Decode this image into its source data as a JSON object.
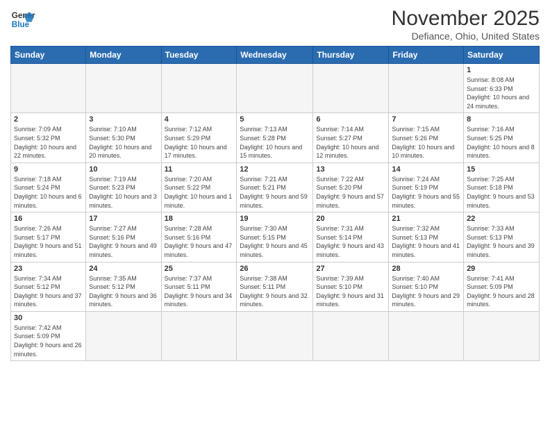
{
  "header": {
    "logo_general": "General",
    "logo_blue": "Blue",
    "month_title": "November 2025",
    "location": "Defiance, Ohio, United States"
  },
  "days_of_week": [
    "Sunday",
    "Monday",
    "Tuesday",
    "Wednesday",
    "Thursday",
    "Friday",
    "Saturday"
  ],
  "weeks": [
    [
      {
        "day": "",
        "info": ""
      },
      {
        "day": "",
        "info": ""
      },
      {
        "day": "",
        "info": ""
      },
      {
        "day": "",
        "info": ""
      },
      {
        "day": "",
        "info": ""
      },
      {
        "day": "",
        "info": ""
      },
      {
        "day": "1",
        "info": "Sunrise: 8:08 AM\nSunset: 6:33 PM\nDaylight: 10 hours and 24 minutes."
      }
    ],
    [
      {
        "day": "2",
        "info": "Sunrise: 7:09 AM\nSunset: 5:32 PM\nDaylight: 10 hours and 22 minutes."
      },
      {
        "day": "3",
        "info": "Sunrise: 7:10 AM\nSunset: 5:30 PM\nDaylight: 10 hours and 20 minutes."
      },
      {
        "day": "4",
        "info": "Sunrise: 7:12 AM\nSunset: 5:29 PM\nDaylight: 10 hours and 17 minutes."
      },
      {
        "day": "5",
        "info": "Sunrise: 7:13 AM\nSunset: 5:28 PM\nDaylight: 10 hours and 15 minutes."
      },
      {
        "day": "6",
        "info": "Sunrise: 7:14 AM\nSunset: 5:27 PM\nDaylight: 10 hours and 12 minutes."
      },
      {
        "day": "7",
        "info": "Sunrise: 7:15 AM\nSunset: 5:26 PM\nDaylight: 10 hours and 10 minutes."
      },
      {
        "day": "8",
        "info": "Sunrise: 7:16 AM\nSunset: 5:25 PM\nDaylight: 10 hours and 8 minutes."
      }
    ],
    [
      {
        "day": "9",
        "info": "Sunrise: 7:18 AM\nSunset: 5:24 PM\nDaylight: 10 hours and 6 minutes."
      },
      {
        "day": "10",
        "info": "Sunrise: 7:19 AM\nSunset: 5:23 PM\nDaylight: 10 hours and 3 minutes."
      },
      {
        "day": "11",
        "info": "Sunrise: 7:20 AM\nSunset: 5:22 PM\nDaylight: 10 hours and 1 minute."
      },
      {
        "day": "12",
        "info": "Sunrise: 7:21 AM\nSunset: 5:21 PM\nDaylight: 9 hours and 59 minutes."
      },
      {
        "day": "13",
        "info": "Sunrise: 7:22 AM\nSunset: 5:20 PM\nDaylight: 9 hours and 57 minutes."
      },
      {
        "day": "14",
        "info": "Sunrise: 7:24 AM\nSunset: 5:19 PM\nDaylight: 9 hours and 55 minutes."
      },
      {
        "day": "15",
        "info": "Sunrise: 7:25 AM\nSunset: 5:18 PM\nDaylight: 9 hours and 53 minutes."
      }
    ],
    [
      {
        "day": "16",
        "info": "Sunrise: 7:26 AM\nSunset: 5:17 PM\nDaylight: 9 hours and 51 minutes."
      },
      {
        "day": "17",
        "info": "Sunrise: 7:27 AM\nSunset: 5:16 PM\nDaylight: 9 hours and 49 minutes."
      },
      {
        "day": "18",
        "info": "Sunrise: 7:28 AM\nSunset: 5:16 PM\nDaylight: 9 hours and 47 minutes."
      },
      {
        "day": "19",
        "info": "Sunrise: 7:30 AM\nSunset: 5:15 PM\nDaylight: 9 hours and 45 minutes."
      },
      {
        "day": "20",
        "info": "Sunrise: 7:31 AM\nSunset: 5:14 PM\nDaylight: 9 hours and 43 minutes."
      },
      {
        "day": "21",
        "info": "Sunrise: 7:32 AM\nSunset: 5:13 PM\nDaylight: 9 hours and 41 minutes."
      },
      {
        "day": "22",
        "info": "Sunrise: 7:33 AM\nSunset: 5:13 PM\nDaylight: 9 hours and 39 minutes."
      }
    ],
    [
      {
        "day": "23",
        "info": "Sunrise: 7:34 AM\nSunset: 5:12 PM\nDaylight: 9 hours and 37 minutes."
      },
      {
        "day": "24",
        "info": "Sunrise: 7:35 AM\nSunset: 5:12 PM\nDaylight: 9 hours and 36 minutes."
      },
      {
        "day": "25",
        "info": "Sunrise: 7:37 AM\nSunset: 5:11 PM\nDaylight: 9 hours and 34 minutes."
      },
      {
        "day": "26",
        "info": "Sunrise: 7:38 AM\nSunset: 5:11 PM\nDaylight: 9 hours and 32 minutes."
      },
      {
        "day": "27",
        "info": "Sunrise: 7:39 AM\nSunset: 5:10 PM\nDaylight: 9 hours and 31 minutes."
      },
      {
        "day": "28",
        "info": "Sunrise: 7:40 AM\nSunset: 5:10 PM\nDaylight: 9 hours and 29 minutes."
      },
      {
        "day": "29",
        "info": "Sunrise: 7:41 AM\nSunset: 5:09 PM\nDaylight: 9 hours and 28 minutes."
      }
    ],
    [
      {
        "day": "30",
        "info": "Sunrise: 7:42 AM\nSunset: 5:09 PM\nDaylight: 9 hours and 26 minutes."
      },
      {
        "day": "",
        "info": ""
      },
      {
        "day": "",
        "info": ""
      },
      {
        "day": "",
        "info": ""
      },
      {
        "day": "",
        "info": ""
      },
      {
        "day": "",
        "info": ""
      },
      {
        "day": "",
        "info": ""
      }
    ]
  ]
}
